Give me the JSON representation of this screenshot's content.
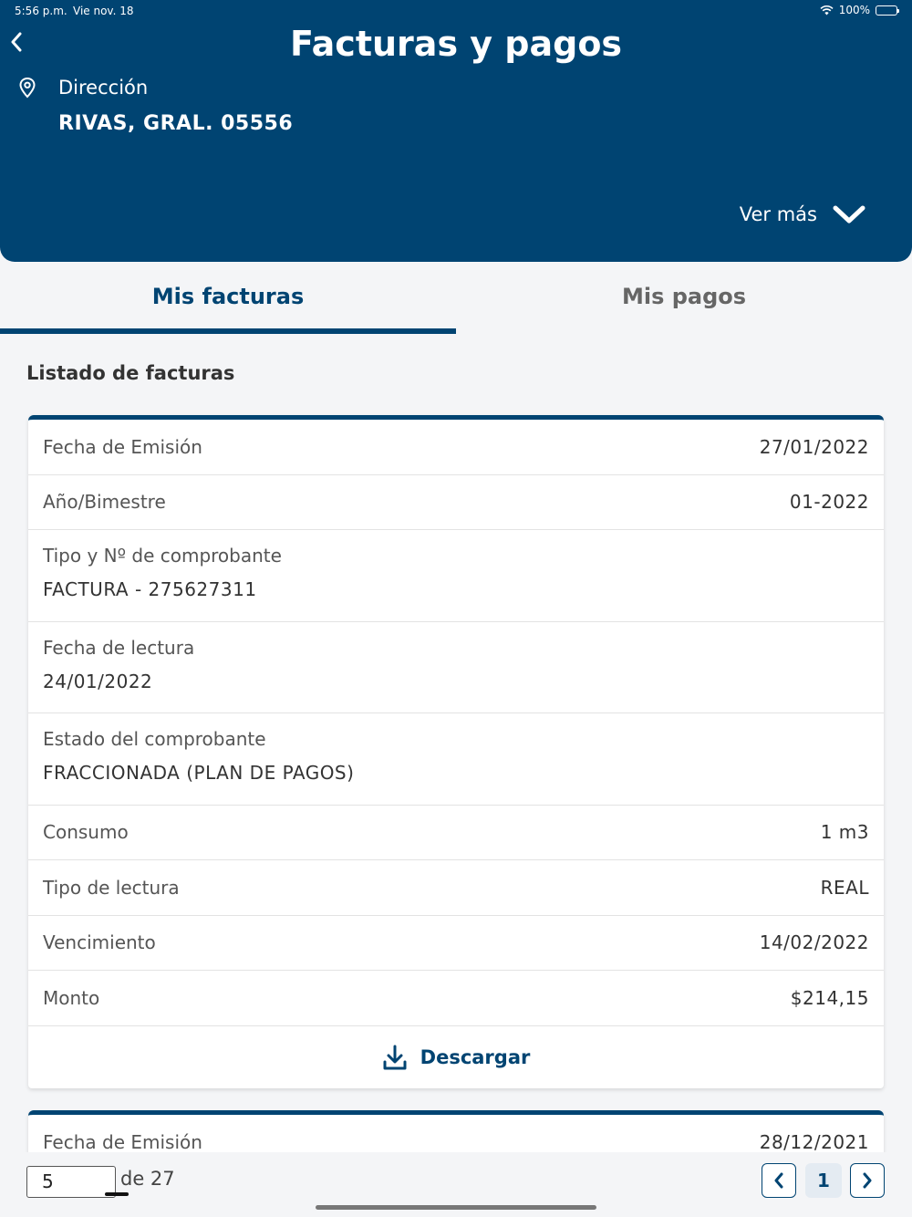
{
  "status_bar": {
    "time": "5:56 p.m.",
    "date": "Vie nov. 18",
    "battery": "100%"
  },
  "header": {
    "title": "Facturas y pagos",
    "direccion_label": "Dirección",
    "direccion_value": "RIVAS, GRAL. 05556",
    "ver_mas": "Ver más"
  },
  "tabs": [
    {
      "label": "Mis facturas",
      "active": true
    },
    {
      "label": "Mis pagos",
      "active": false
    }
  ],
  "list_title": "Listado de facturas",
  "invoices": [
    {
      "fecha_emision": {
        "label": "Fecha de Emisión",
        "value": "27/01/2022"
      },
      "anio_bimestre": {
        "label": "Año/Bimestre",
        "value": "01-2022"
      },
      "comprobante": {
        "label": "Tipo y Nº de comprobante",
        "value": "FACTURA - 275627311"
      },
      "fecha_lectura": {
        "label": "Fecha de lectura",
        "value": "24/01/2022"
      },
      "estado": {
        "label": "Estado del comprobante",
        "value": "FRACCIONADA (PLAN DE PAGOS)"
      },
      "consumo": {
        "label": "Consumo",
        "value": "1 m3"
      },
      "tipo_lectura": {
        "label": "Tipo de lectura",
        "value": "REAL"
      },
      "vencimiento": {
        "label": "Vencimiento",
        "value": "14/02/2022"
      },
      "monto": {
        "label": "Monto",
        "value": "$214,15"
      },
      "download_label": "Descargar"
    },
    {
      "fecha_emision": {
        "label": "Fecha de Emisión",
        "value": "28/12/2021"
      }
    }
  ],
  "pagination": {
    "page_input_value": "5",
    "of_total": "de 27",
    "current_page": "1"
  },
  "colors": {
    "primary": "#004472",
    "background": "#f4f5f7",
    "active_page_bg": "#e4ebf2"
  },
  "icons": {
    "back": "chevron-left-icon",
    "location": "map-pin-icon",
    "expand": "chevron-down-icon",
    "download": "download-icon",
    "prev": "chevron-left-icon",
    "next": "chevron-right-icon"
  }
}
